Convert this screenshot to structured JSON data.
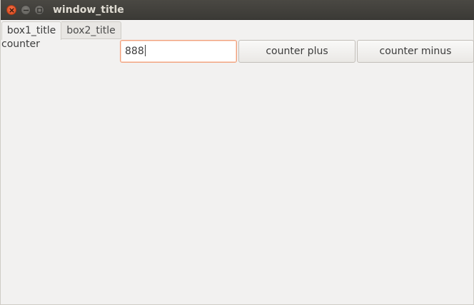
{
  "window": {
    "title": "window_title"
  },
  "tabs": [
    {
      "label": "box1_title",
      "active": true
    },
    {
      "label": "box2_title",
      "active": false
    }
  ],
  "content": {
    "counter_label": "counter",
    "counter_value": "888",
    "plus_label": "counter plus",
    "minus_label": "counter minus"
  },
  "colors": {
    "titlebar": "#3b3a36",
    "background": "#f2f1f0",
    "close_button": "#e95420",
    "focus_border": "#f0a07c"
  },
  "icons": {
    "close": "close-icon",
    "minimize": "minimize-icon",
    "maximize": "maximize-icon"
  }
}
